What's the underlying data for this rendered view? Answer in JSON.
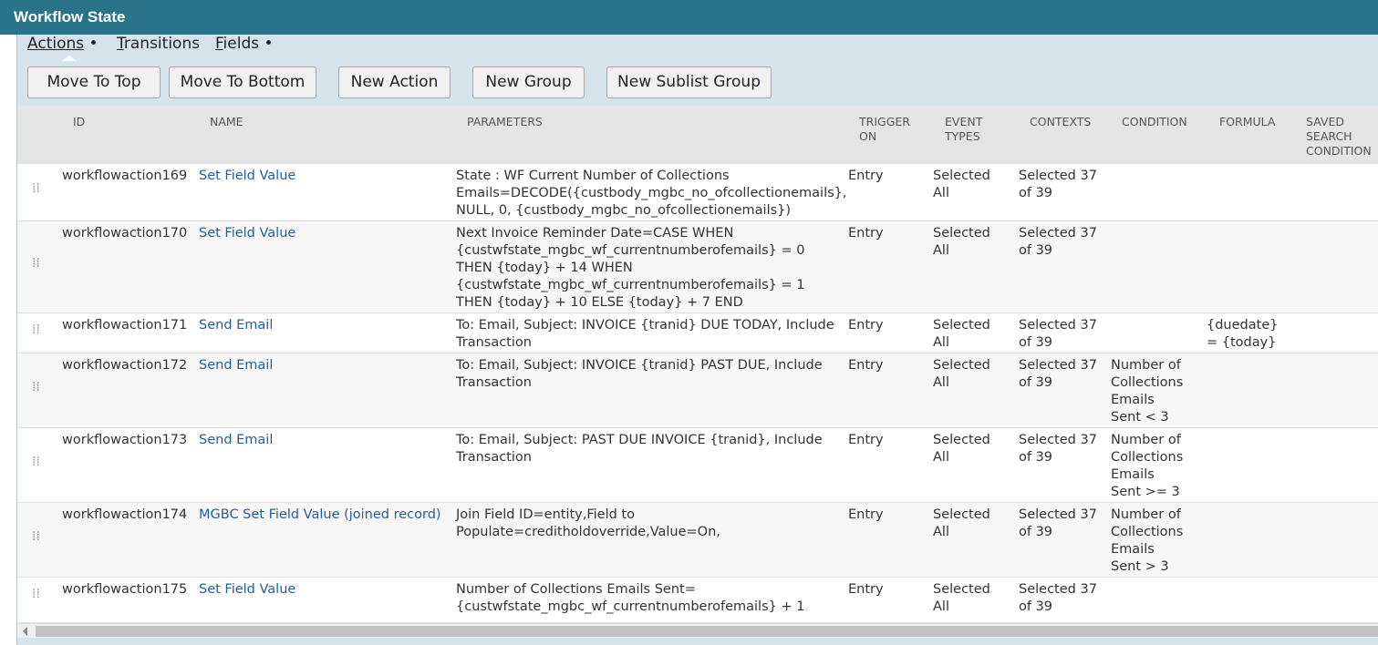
{
  "window": {
    "title": "Workflow State"
  },
  "tabs": [
    {
      "label": "Actions",
      "underline": "A",
      "rest": "ctions",
      "dot": "•",
      "active": true
    },
    {
      "label": "Transitions",
      "underline": "T",
      "rest": "ransitions",
      "dot": ""
    },
    {
      "label": "Fields",
      "underline": "F",
      "rest": "ields",
      "dot": "•"
    }
  ],
  "buttons": {
    "move_to_top": "Move To Top",
    "move_to_bottom": "Move To Bottom",
    "new_action": "New Action",
    "new_group": "New Group",
    "new_sublist_group": "New Sublist Group"
  },
  "columns": {
    "id": "ID",
    "name": "NAME",
    "parameters": "PARAMETERS",
    "trigger_on": "TRIGGER ON",
    "event_types": "EVENT TYPES",
    "contexts": "CONTEXTS",
    "condition": "CONDITION",
    "formula": "FORMULA",
    "saved_search_condition": "SAVED SEARCH CONDITION"
  },
  "rows": [
    {
      "id": "workflowaction169",
      "name": "Set Field Value",
      "parameters": "State : WF Current Number of Collections Emails=DECODE({custbody_mgbc_no_ofcollectionemails}, NULL, 0, {custbody_mgbc_no_ofcollectionemails})",
      "trigger_on": "Entry",
      "event_types": "Selected All",
      "contexts": "Selected 37 of 39",
      "condition": "",
      "formula": "",
      "saved_search_condition": ""
    },
    {
      "id": "workflowaction170",
      "name": "Set Field Value",
      "parameters": "Next Invoice Reminder Date=CASE WHEN {custwfstate_mgbc_wf_currentnumberofemails} = 0 THEN {today} + 14 WHEN {custwfstate_mgbc_wf_currentnumberofemails} = 1 THEN {today} + 10 ELSE {today} + 7 END",
      "trigger_on": "Entry",
      "event_types": "Selected All",
      "contexts": "Selected 37 of 39",
      "condition": "",
      "formula": "",
      "saved_search_condition": ""
    },
    {
      "id": "workflowaction171",
      "name": "Send Email",
      "parameters": "To: Email, Subject: INVOICE {tranid} DUE TODAY, Include Transaction",
      "trigger_on": "Entry",
      "event_types": "Selected All",
      "contexts": "Selected 37 of 39",
      "condition": "",
      "formula": "{duedate} = {today}",
      "saved_search_condition": ""
    },
    {
      "id": "workflowaction172",
      "name": "Send Email",
      "parameters": "To: Email, Subject: INVOICE {tranid} PAST DUE, Include Transaction",
      "trigger_on": "Entry",
      "event_types": "Selected All",
      "contexts": "Selected 37 of 39",
      "condition": "Number of Collections Emails Sent < 3",
      "formula": "",
      "saved_search_condition": ""
    },
    {
      "id": "workflowaction173",
      "name": "Send Email",
      "parameters": "To: Email, Subject: PAST DUE INVOICE {tranid}, Include Transaction",
      "trigger_on": "Entry",
      "event_types": "Selected All",
      "contexts": "Selected 37 of 39",
      "condition": "Number of Collections Emails Sent >= 3",
      "formula": "",
      "saved_search_condition": ""
    },
    {
      "id": "workflowaction174",
      "name": "MGBC Set Field Value (joined record)",
      "parameters": "Join Field ID=entity,Field to Populate=creditholdoverride,Value=On,",
      "trigger_on": "Entry",
      "event_types": "Selected All",
      "contexts": "Selected 37 of 39",
      "condition": "Number of Collections Emails Sent > 3",
      "formula": "",
      "saved_search_condition": ""
    },
    {
      "id": "workflowaction175",
      "name": "Set Field Value",
      "parameters": "Number of Collections Emails Sent= {custwfstate_mgbc_wf_currentnumberofemails} + 1",
      "trigger_on": "Entry",
      "event_types": "Selected All",
      "contexts": "Selected 37 of 39",
      "condition": "",
      "formula": "",
      "saved_search_condition": ""
    }
  ],
  "icons": {
    "drag_handle": "drag-handle-icon",
    "scroll_left": "chevron-left-icon"
  }
}
